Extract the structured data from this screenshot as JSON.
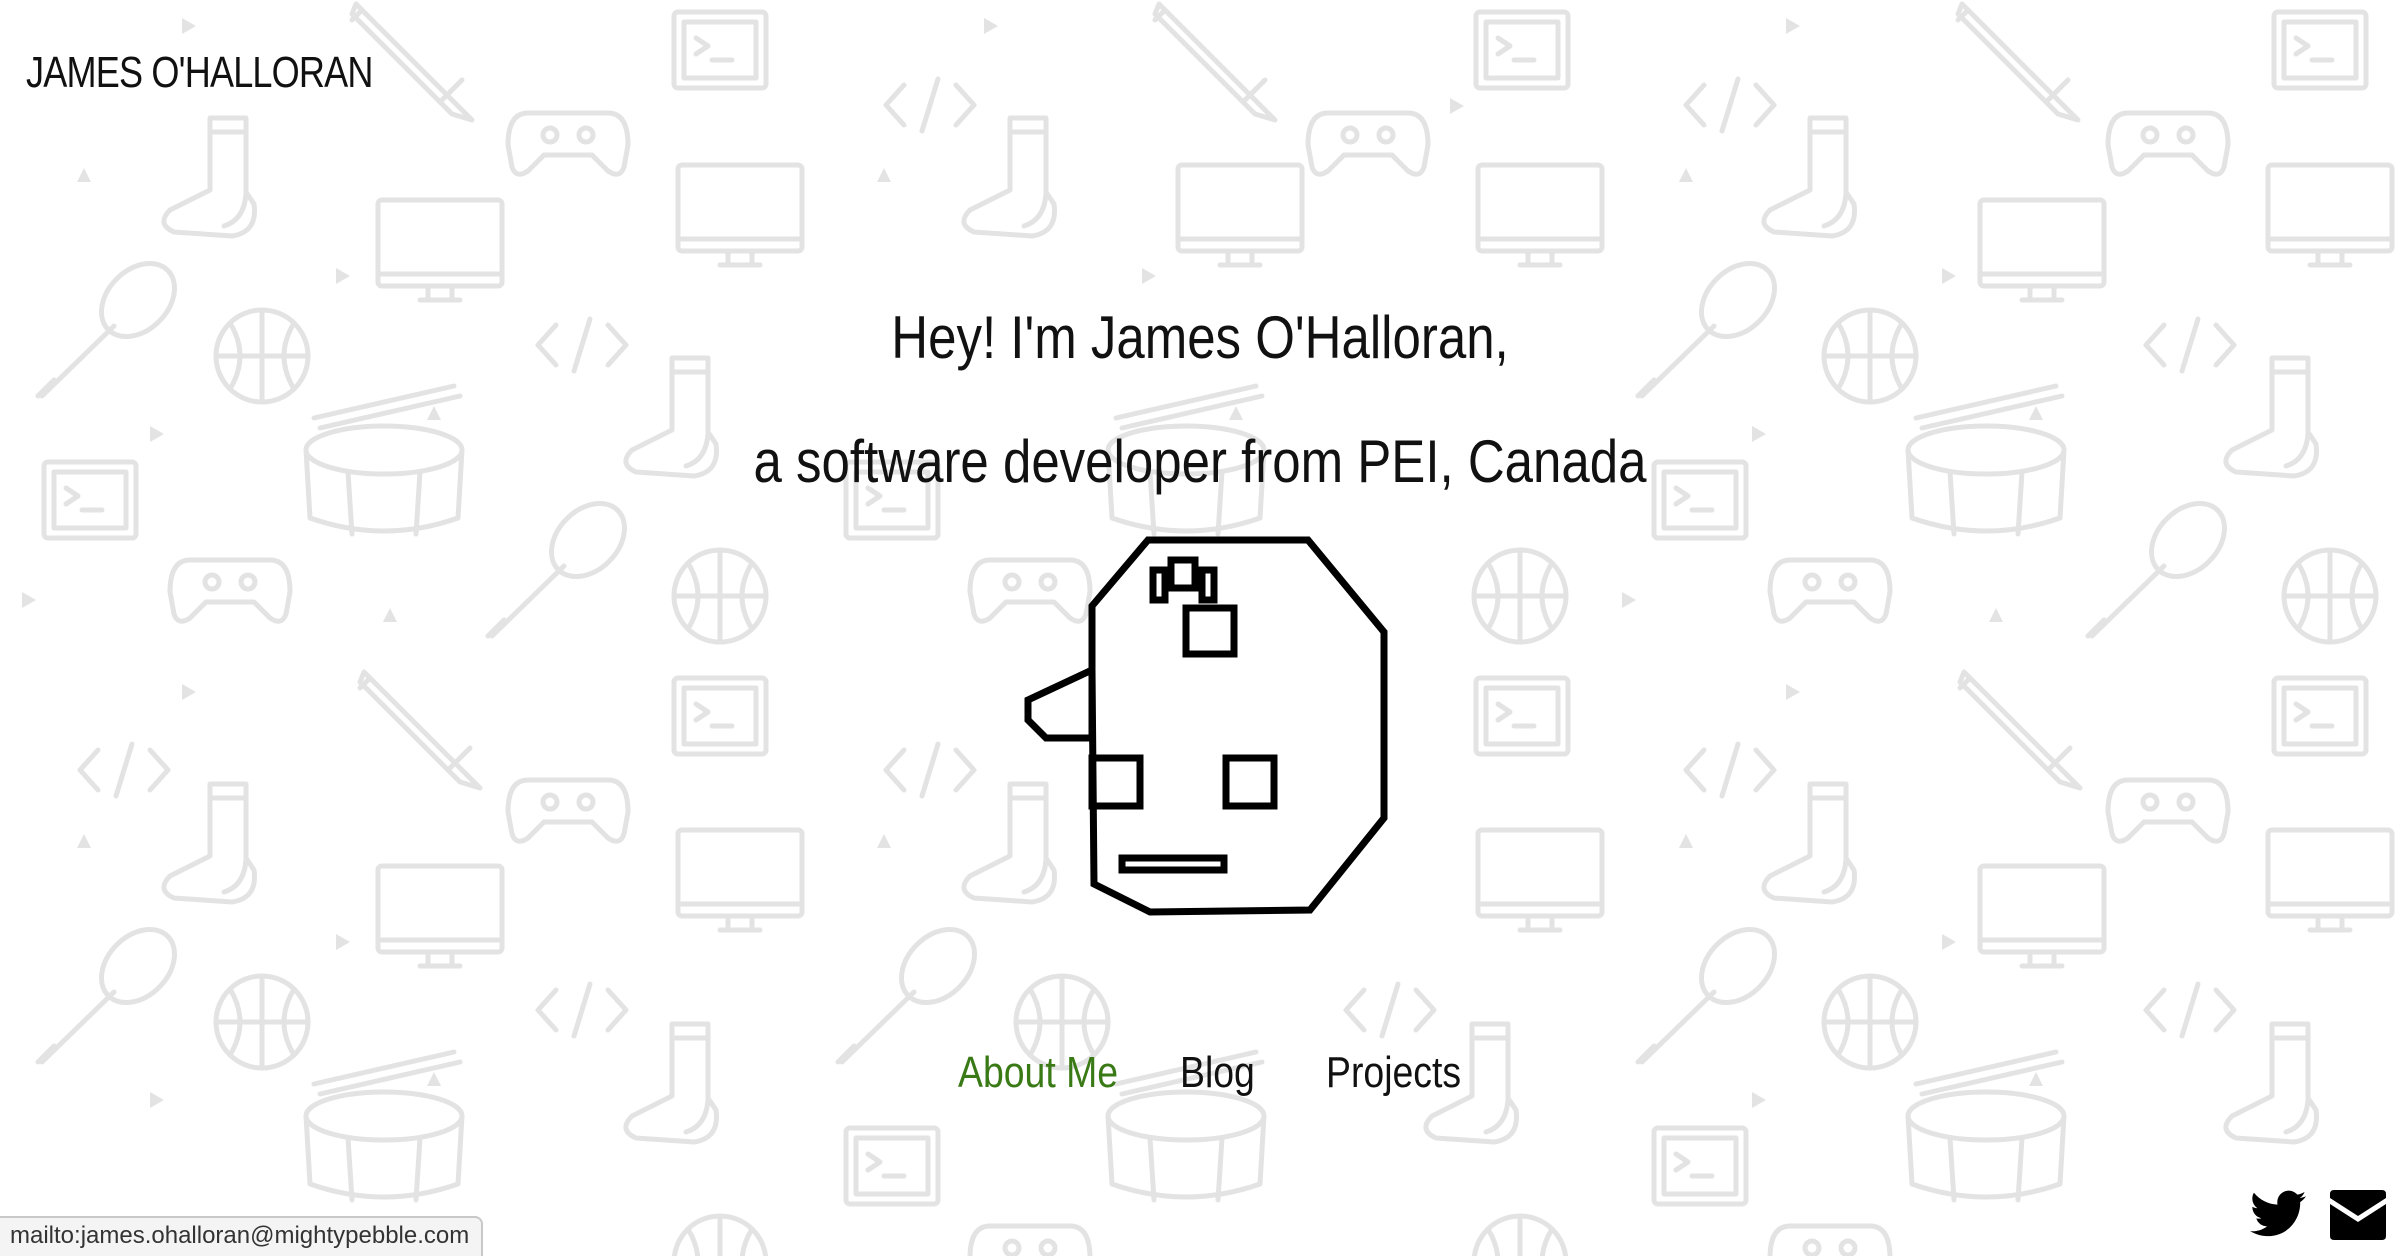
{
  "site": {
    "title": "JAMES O'HALLORAN"
  },
  "intro": {
    "line1": "Hey! I'm James O'Halloran,",
    "line2": "a software developer from PEI, Canada"
  },
  "nav": {
    "items": [
      {
        "label": "About Me",
        "active": true
      },
      {
        "label": "Blog",
        "active": false
      },
      {
        "label": "Projects",
        "active": false
      }
    ]
  },
  "social": {
    "icons": [
      "twitter-icon",
      "email-icon"
    ]
  },
  "status_bar": {
    "text": "mailto:james.ohalloran@mightypebble.com"
  },
  "colors": {
    "accent": "#3a7a16",
    "text": "#111111",
    "pattern": "#e3e3e3",
    "background": "#ffffff"
  }
}
